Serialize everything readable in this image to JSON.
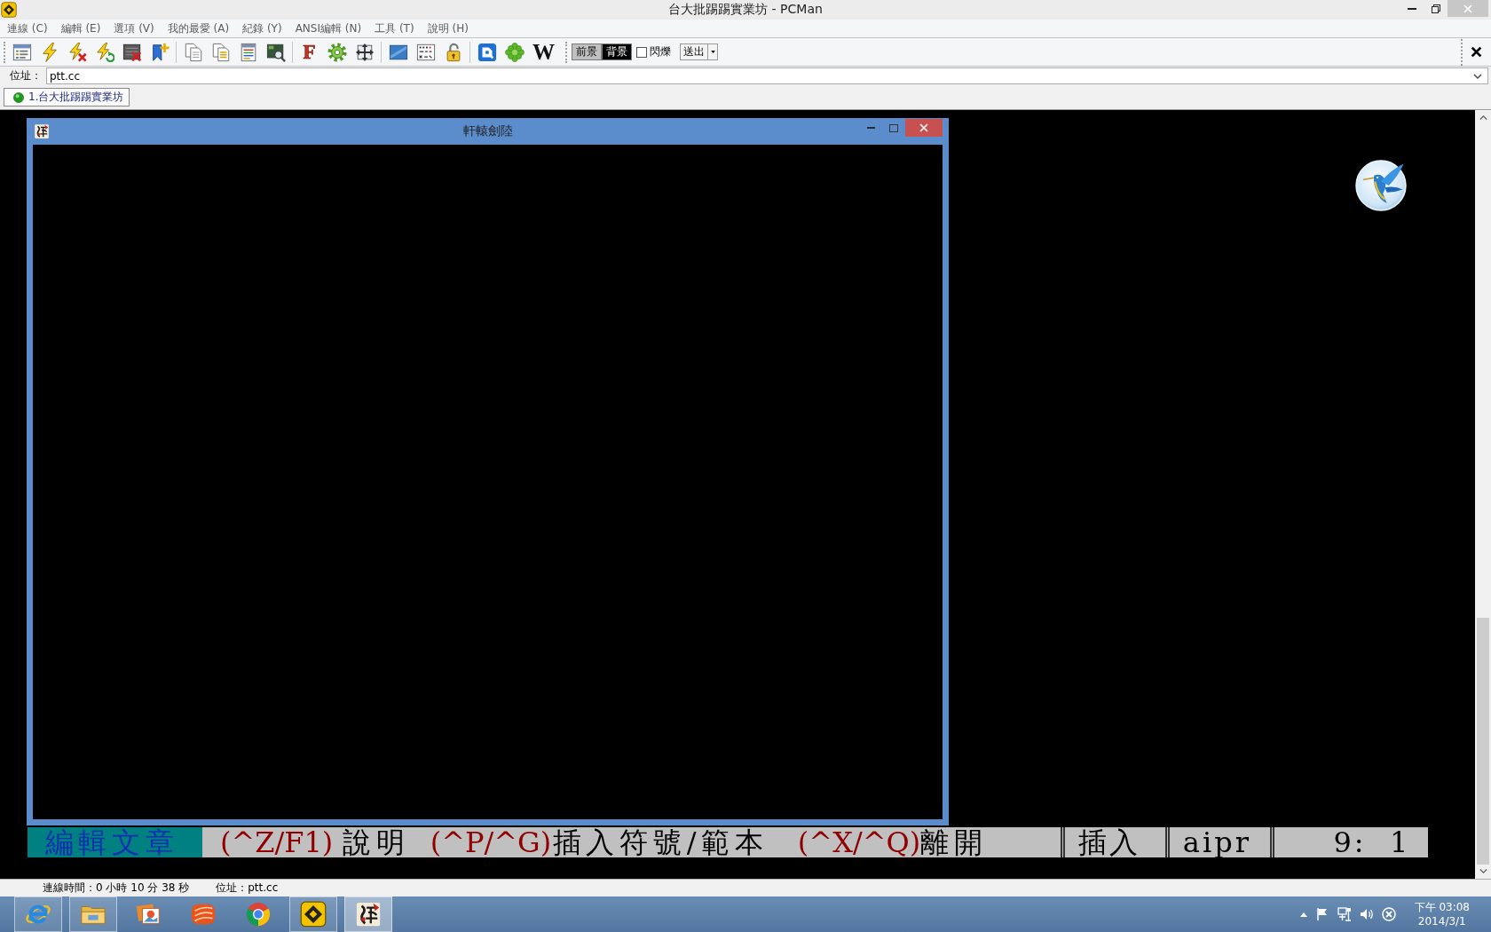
{
  "window": {
    "title": "台大批踢踢實業坊 - PCMan"
  },
  "menu": [
    "連線 (C)",
    "編輯 (E)",
    "選項 (V)",
    "我的最愛 (A)",
    "紀錄 (Y)",
    "ANSI編輯 (N)",
    "工具 (T)",
    "說明 (H)"
  ],
  "toolbar": {
    "glyph_buttons": [
      "F",
      "W"
    ],
    "color_buttons": [
      {
        "label": "前景",
        "color": "#c0c0c0"
      },
      {
        "label": "背景",
        "color": "#000000"
      }
    ],
    "blink": {
      "label": "閃爍",
      "checked": false
    },
    "send_button": "送出"
  },
  "address_bar": {
    "label": "位址：",
    "value": "ptt.cc"
  },
  "tabs": [
    {
      "label": "1.台大批踢踢實業坊",
      "selected": true,
      "connected": true
    }
  ],
  "terminal": {
    "game_window": {
      "title": "軒轅劍陸"
    },
    "editor_status_line": {
      "mode": "編輯文章",
      "commands": [
        {
          "keys": "(^Z/F1)",
          "label": "說明"
        },
        {
          "keys": "(^P/^G)",
          "label": "插入符號/範本"
        },
        {
          "keys": "(^X/^Q)",
          "label": "離開"
        }
      ],
      "fields": [
        "插入",
        "aipr",
        "9:  1"
      ]
    }
  },
  "status_bar": {
    "items": [
      "連線時間：0 小時 10 分 38 秒",
      "位址：ptt.cc"
    ]
  },
  "taskbar": {
    "buttons": [
      {
        "kind": "browser",
        "running": true,
        "selected": false
      },
      {
        "kind": "folder",
        "running": true,
        "selected": false
      },
      {
        "kind": "pictures",
        "running": false,
        "selected": false
      },
      {
        "kind": "swoosh",
        "running": false,
        "selected": false
      },
      {
        "kind": "circle",
        "running": false,
        "selected": false
      },
      {
        "kind": "logo",
        "running": true,
        "selected": false
      },
      {
        "kind": "game",
        "running": true,
        "selected": true
      }
    ],
    "clock": {
      "time": "下午 03:08",
      "date": "2014/3/1"
    }
  }
}
